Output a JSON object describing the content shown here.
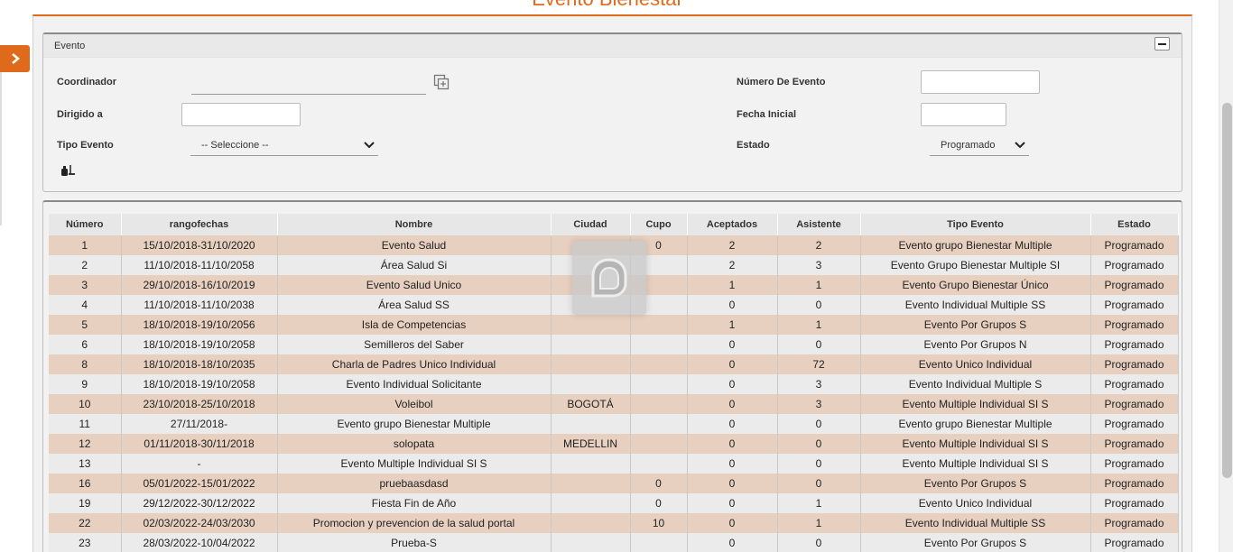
{
  "page": {
    "title": "Evento Bienestar"
  },
  "filters": {
    "panel_title": "Evento",
    "coordinador_label": "Coordinador",
    "coordinador_value": "",
    "dirigido_label": "Dirigido a",
    "dirigido_value": "",
    "tipo_evento_label": "Tipo Evento",
    "tipo_evento_selected": "-- Seleccione --",
    "numero_evento_label": "Número De Evento",
    "numero_evento_value": "",
    "fecha_inicial_label": "Fecha Inicial",
    "fecha_inicial_value": "",
    "estado_label": "Estado",
    "estado_selected": "Programado"
  },
  "table": {
    "columns": [
      "Número",
      "rangofechas",
      "Nombre",
      "Ciudad",
      "Cupo",
      "Aceptados",
      "Asistente",
      "Tipo Evento",
      "Estado"
    ],
    "rows": [
      [
        "1",
        "15/10/2018-31/10/2020",
        "Evento Salud",
        "",
        "0",
        "2",
        "2",
        "Evento grupo Bienestar Multiple",
        "Programado"
      ],
      [
        "2",
        "11/10/2018-11/10/2058",
        "Área Salud Si",
        "",
        "",
        "2",
        "3",
        "Evento Grupo Bienestar Multiple SI",
        "Programado"
      ],
      [
        "3",
        "29/10/2018-16/10/2019",
        "Evento Salud Unico",
        "",
        "",
        "1",
        "1",
        "Evento Grupo Bienestar Único",
        "Programado"
      ],
      [
        "4",
        "11/10/2018-11/10/2038",
        "Área Salud SS",
        "",
        "",
        "0",
        "0",
        "Evento Individual Multiple SS",
        "Programado"
      ],
      [
        "5",
        "18/10/2018-19/10/2056",
        "Isla de Competencias",
        "",
        "",
        "1",
        "1",
        "Evento Por Grupos S",
        "Programado"
      ],
      [
        "6",
        "18/10/2018-19/10/2058",
        "Semilleros del Saber",
        "",
        "",
        "0",
        "0",
        "Evento Por Grupos N",
        "Programado"
      ],
      [
        "8",
        "18/10/2018-18/10/2035",
        "Charla de Padres Unico Individual",
        "",
        "",
        "0",
        "72",
        "Evento Unico Individual",
        "Programado"
      ],
      [
        "9",
        "18/10/2018-19/10/2058",
        "Evento Individual Solicitante",
        "",
        "",
        "0",
        "3",
        "Evento Individual Multiple S",
        "Programado"
      ],
      [
        "10",
        "23/10/2018-25/10/2018",
        "Voleibol",
        "BOGOTÁ",
        "",
        "0",
        "3",
        "Evento Multiple Individual SI S",
        "Programado"
      ],
      [
        "11",
        "27/11/2018-",
        "Evento grupo Bienestar Multiple",
        "",
        "",
        "0",
        "0",
        "Evento grupo Bienestar Multiple",
        "Programado"
      ],
      [
        "12",
        "01/11/2018-30/11/2018",
        "solopata",
        "MEDELLIN",
        "",
        "0",
        "0",
        "Evento Multiple Individual SI S",
        "Programado"
      ],
      [
        "13",
        "-",
        "Evento Multiple Individual SI S",
        "",
        "",
        "0",
        "0",
        "Evento Multiple Individual SI S",
        "Programado"
      ],
      [
        "16",
        "05/01/2022-15/01/2022",
        "pruebaasdasd",
        "",
        "0",
        "0",
        "0",
        "Evento Por Grupos S",
        "Programado"
      ],
      [
        "19",
        "29/12/2022-30/12/2022",
        "Fiesta Fin de Año",
        "",
        "0",
        "0",
        "1",
        "Evento Unico Individual",
        "Programado"
      ],
      [
        "22",
        "02/03/2022-24/03/2030",
        "Promocion y prevencion de la salud portal",
        "",
        "10",
        "0",
        "1",
        "Evento Individual Multiple SS",
        "Programado"
      ],
      [
        "23",
        "28/03/2022-10/04/2022",
        "Prueba-S",
        "",
        "",
        "0",
        "0",
        "Evento Por Grupos S",
        "Programado"
      ]
    ]
  },
  "icons": {
    "sidebar_toggle": "chevron-right-icon",
    "collapse": "minus-icon",
    "coordinador_search": "add-window-icon",
    "clear_filters": "broom-icon",
    "loader": "loading-logo-icon"
  },
  "colors": {
    "accent": "#e06a1c",
    "row_odd": "#e8d0c0",
    "row_even": "#ebebeb"
  }
}
